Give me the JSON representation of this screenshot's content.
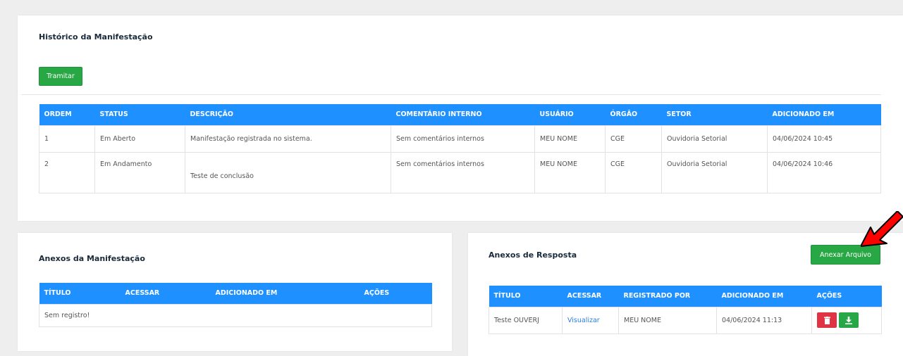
{
  "history": {
    "title": "Histórico da Manifestação",
    "tramitar_label": "Tramitar",
    "columns": [
      "ORDEM",
      "STATUS",
      "DESCRIÇÃO",
      "COMENTÁRIO INTERNO",
      "USUÁRIO",
      "ÓRGÃO",
      "SETOR",
      "ADICIONADO EM"
    ],
    "rows": [
      [
        "1",
        "Em Aberto",
        "Manifestação registrada no sistema.",
        "Sem comentários internos",
        "MEU NOME",
        "CGE",
        "Ouvidoria Setorial",
        "04/06/2024 10:45"
      ],
      [
        "2",
        "Em Andamento",
        "Teste de conclusão",
        "Sem comentários internos",
        "MEU NOME",
        "CGE",
        "Ouvidoria Setorial",
        "04/06/2024 10:46"
      ]
    ]
  },
  "attachments": {
    "title": "Anexos da Manifestação",
    "columns": [
      "TÍTULO",
      "ACESSAR",
      "ADICIONADO EM",
      "AÇÕES"
    ],
    "empty_text": "Sem registro!"
  },
  "replies": {
    "title": "Anexos de Resposta",
    "attach_label": "Anexar Arquivo",
    "columns": [
      "TÍTULO",
      "ACESSAR",
      "REGISTRADO POR",
      "ADICIONADO EM",
      "AÇÕES"
    ],
    "rows": [
      {
        "title": "Teste OUVERJ",
        "link": "Visualizar",
        "by": "MEU NOME",
        "date": "04/06/2024 11:13"
      }
    ]
  },
  "icons": {
    "delete": "trash-icon",
    "download": "download-icon",
    "pointer": "red-arrow-annotation"
  },
  "colors": {
    "header_blue": "#1e90ff",
    "button_green": "#28a745",
    "delete_red": "#e03445",
    "arrow_red": "#ff0000",
    "link_blue": "#2a7fe0"
  }
}
